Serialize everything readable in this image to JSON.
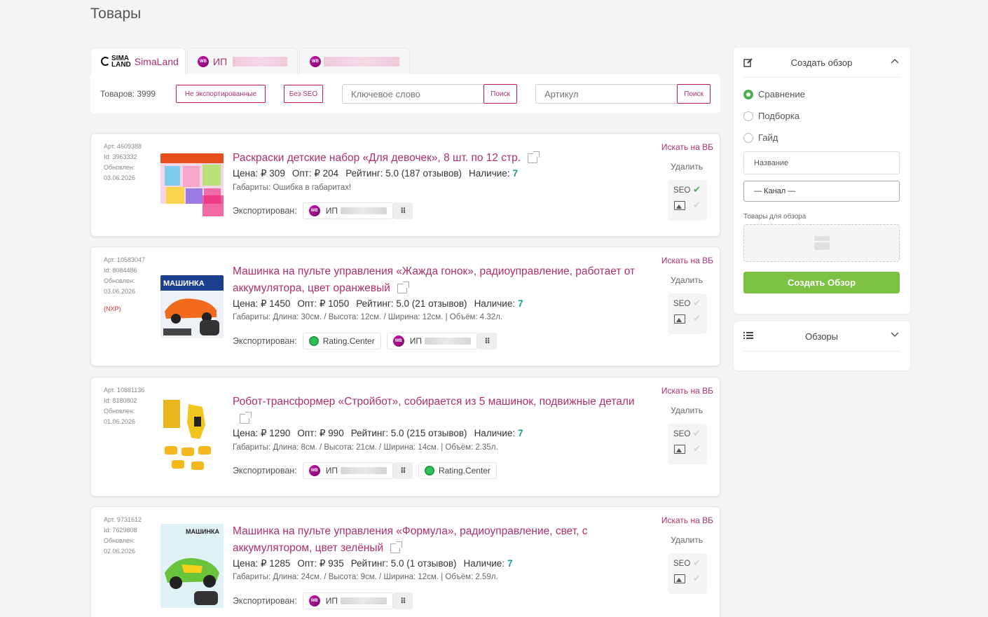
{
  "page": {
    "title": "Товары"
  },
  "tabs": [
    {
      "label": "SimaLand",
      "logo": "SIMA LAND"
    },
    {
      "label": "ИП"
    },
    {
      "label": ""
    }
  ],
  "toolbar": {
    "count": "Товаров: 3999",
    "not_exported": "Не экспортированные",
    "no_seo": "Без SEO",
    "keyword_placeholder": "Ключевое слово",
    "search_label": "Поиск",
    "article_placeholder": "Артикул",
    "search2_label": "Поиск"
  },
  "wb_badge": "WB",
  "products": [
    {
      "art": "Арт. 4609388",
      "id": "Id: 3963332",
      "updated_label": "Обновлен:",
      "updated": "03.06.2026",
      "title": "Раскраски детские набор «Для девочек», 8 шт. по 12 стр.",
      "price": "Цена: ₽ 309",
      "opt": "Опт: ₽ 204",
      "rating": "Рейтинг: 5.0 (187 отзывов)",
      "avail_label": "Наличие:",
      "avail": "7",
      "dims": "Габариты: Ошибка в габаритах!",
      "exported_label": "Экспортирован:",
      "chips": [
        "ИП"
      ],
      "seo_ok": true
    },
    {
      "art": "Арт. 10583047",
      "id": "Id: 8084486",
      "updated_label": "Обновлен:",
      "updated": "03.06.2026",
      "nxp": "(NXP)",
      "title": "Машинка на пульте управления «Жажда гонок», радиоуправление, работает от аккумулятора, цвет оранжевый",
      "price": "Цена: ₽ 1450",
      "opt": "Опт: ₽ 1050",
      "rating": "Рейтинг: 5.0 (21 отзывов)",
      "avail_label": "Наличие:",
      "avail": "7",
      "dims": "Габариты: Длина: 30см. / Высота: 12см. / Ширина: 12см. | Объём: 4.32л.",
      "exported_label": "Экспортирован:",
      "chips": [
        "Rating.Center",
        "ИП"
      ],
      "seo_ok": false
    },
    {
      "art": "Арт. 10881136",
      "id": "Id: 8180802",
      "updated_label": "Обновлен:",
      "updated": "01.06.2026",
      "title": "Робот-трансформер «Стройбот», собирается из 5 машинок, подвижные детали",
      "price": "Цена: ₽ 1290",
      "opt": "Опт: ₽ 990",
      "rating": "Рейтинг: 5.0 (215 отзывов)",
      "avail_label": "Наличие:",
      "avail": "7",
      "dims": "Габариты: Длина: 8см. / Высота: 21см. / Ширина: 14см. | Объём: 2.35л.",
      "exported_label": "Экспортирован:",
      "chips": [
        "ИП",
        "Rating.Center"
      ],
      "seo_ok": false
    },
    {
      "art": "Арт. 9731612",
      "id": "Id: 7629808",
      "updated_label": "Обновлен:",
      "updated": "02.06.2026",
      "title": "Машинка на пульте управления «Формула», радиоуправление, свет, с аккумулятором, цвет зелёный",
      "price": "Цена: ₽ 1285",
      "opt": "Опт: ₽ 935",
      "rating": "Рейтинг: 5.0 (1 отзывов)",
      "avail_label": "Наличие:",
      "avail": "7",
      "dims": "Габариты: Длина: 24см. / Высота: 9см. / Ширина: 12см. | Объём: 2.59л.",
      "exported_label": "Экспортирован:",
      "chips": [
        "ИП"
      ],
      "seo_ok": false
    }
  ],
  "card_actions": {
    "search_wb": "Искать на ВБ",
    "delete": "Удалить",
    "seo": "SEO"
  },
  "review_panel": {
    "title": "Создать обзор",
    "options": [
      "Сравнение",
      "Подборка",
      "Гайд"
    ],
    "selected": "Сравнение",
    "name_placeholder": "Название",
    "channel": "— Канал —",
    "products_label": "Товары для обзора",
    "create_button": "Создать Обзор"
  },
  "reviews_panel": {
    "title": "Обзоры"
  },
  "colors": {
    "accent": "#b0306a",
    "green": "#7cc142",
    "teal": "#1b9a8a"
  }
}
